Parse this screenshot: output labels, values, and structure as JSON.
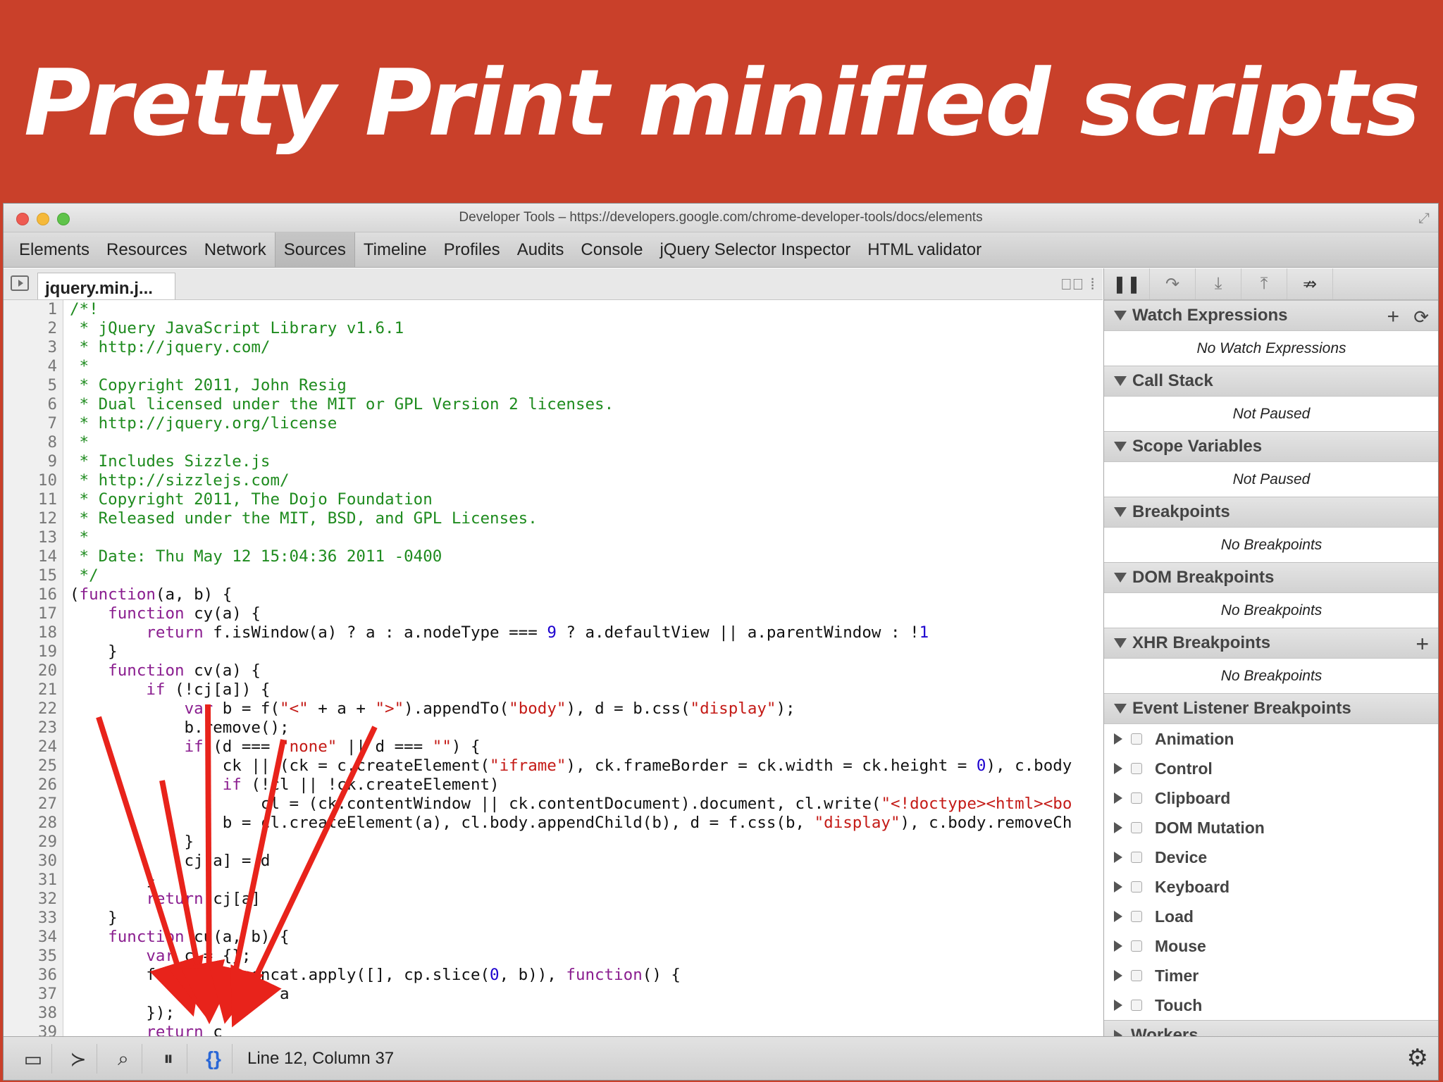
{
  "banner": {
    "title": "Pretty Print minified scripts"
  },
  "window": {
    "title": "Developer Tools – https://developers.google.com/chrome-developer-tools/docs/elements"
  },
  "tabs": [
    "Elements",
    "Resources",
    "Network",
    "Sources",
    "Timeline",
    "Profiles",
    "Audits",
    "Console",
    "jQuery Selector Inspector",
    "HTML validator"
  ],
  "active_tab": "Sources",
  "file": {
    "name": "jquery.min.j..."
  },
  "code_lines": [
    [
      [
        "c",
        "/*!"
      ]
    ],
    [
      [
        "c",
        " * jQuery JavaScript Library v1.6.1"
      ]
    ],
    [
      [
        "c",
        " * http://jquery.com/"
      ]
    ],
    [
      [
        "c",
        " *"
      ]
    ],
    [
      [
        "c",
        " * Copyright 2011, John Resig"
      ]
    ],
    [
      [
        "c",
        " * Dual licensed under the MIT or GPL Version 2 licenses."
      ]
    ],
    [
      [
        "c",
        " * http://jquery.org/license"
      ]
    ],
    [
      [
        "c",
        " *"
      ]
    ],
    [
      [
        "c",
        " * Includes Sizzle.js"
      ]
    ],
    [
      [
        "c",
        " * http://sizzlejs.com/"
      ]
    ],
    [
      [
        "c",
        " * Copyright 2011, The Dojo Foundation"
      ]
    ],
    [
      [
        "c",
        " * Released under the MIT, BSD, and GPL Licenses."
      ]
    ],
    [
      [
        "c",
        " *"
      ]
    ],
    [
      [
        "c",
        " * Date: Thu May 12 15:04:36 2011 -0400"
      ]
    ],
    [
      [
        "c",
        " */"
      ]
    ],
    [
      [
        "p",
        "("
      ],
      [
        "k",
        "function"
      ],
      [
        "p",
        "(a, b) {"
      ]
    ],
    [
      [
        "p",
        "    "
      ],
      [
        "k",
        "function"
      ],
      [
        "p",
        " cy(a) {"
      ]
    ],
    [
      [
        "p",
        "        "
      ],
      [
        "k",
        "return"
      ],
      [
        "p",
        " f.isWindow(a) ? a : a.nodeType === "
      ],
      [
        "n",
        "9"
      ],
      [
        "p",
        " ? a.defaultView || a.parentWindow : !"
      ],
      [
        "n",
        "1"
      ]
    ],
    [
      [
        "p",
        "    }"
      ]
    ],
    [
      [
        "p",
        "    "
      ],
      [
        "k",
        "function"
      ],
      [
        "p",
        " cv(a) {"
      ]
    ],
    [
      [
        "p",
        "        "
      ],
      [
        "k",
        "if"
      ],
      [
        "p",
        " (!cj[a]) {"
      ]
    ],
    [
      [
        "p",
        "            "
      ],
      [
        "k",
        "var"
      ],
      [
        "p",
        " b = f("
      ],
      [
        "s",
        "\"<\""
      ],
      [
        "p",
        " + a + "
      ],
      [
        "s",
        "\">\""
      ],
      [
        "p",
        ").appendTo("
      ],
      [
        "s",
        "\"body\""
      ],
      [
        "p",
        "), d = b.css("
      ],
      [
        "s",
        "\"display\""
      ],
      [
        "p",
        ");"
      ]
    ],
    [
      [
        "p",
        "            b.remove();"
      ]
    ],
    [
      [
        "p",
        "            "
      ],
      [
        "k",
        "if"
      ],
      [
        "p",
        " (d === "
      ],
      [
        "s",
        "\"none\""
      ],
      [
        "p",
        " || d === "
      ],
      [
        "s",
        "\"\""
      ],
      [
        "p",
        ") {"
      ]
    ],
    [
      [
        "p",
        "                ck || (ck = c.createElement("
      ],
      [
        "s",
        "\"iframe\""
      ],
      [
        "p",
        "), ck.frameBorder = ck.width = ck.height = "
      ],
      [
        "n",
        "0"
      ],
      [
        "p",
        "), c.body"
      ]
    ],
    [
      [
        "p",
        "                "
      ],
      [
        "k",
        "if"
      ],
      [
        "p",
        " (!cl || !ck.createElement)"
      ]
    ],
    [
      [
        "p",
        "                    cl = (ck.contentWindow || ck.contentDocument).document, cl.write("
      ],
      [
        "s",
        "\"<!doctype><html><bo"
      ]
    ],
    [
      [
        "p",
        "                b = cl.createElement(a), cl.body.appendChild(b), d = f.css(b, "
      ],
      [
        "s",
        "\"display\""
      ],
      [
        "p",
        "), c.body.removeCh"
      ]
    ],
    [
      [
        "p",
        "            }"
      ]
    ],
    [
      [
        "p",
        "            cj[a] = d"
      ]
    ],
    [
      [
        "p",
        "        }"
      ]
    ],
    [
      [
        "p",
        "        "
      ],
      [
        "k",
        "return"
      ],
      [
        "p",
        " cj[a]"
      ]
    ],
    [
      [
        "p",
        "    }"
      ]
    ],
    [
      [
        "p",
        "    "
      ],
      [
        "k",
        "function"
      ],
      [
        "p",
        " cu(a, b) {"
      ]
    ],
    [
      [
        "p",
        "        "
      ],
      [
        "k",
        "var"
      ],
      [
        "p",
        " c = {};"
      ]
    ],
    [
      [
        "p",
        "        f.each(cp.concat.apply([], cp.slice("
      ],
      [
        "n",
        "0"
      ],
      [
        "p",
        ", b)), "
      ],
      [
        "k",
        "function"
      ],
      [
        "p",
        "() {"
      ]
    ],
    [
      [
        "p",
        "            c[this] = a"
      ]
    ],
    [
      [
        "p",
        "        });"
      ]
    ],
    [
      [
        "p",
        "        "
      ],
      [
        "k",
        "return"
      ],
      [
        "p",
        " c"
      ]
    ]
  ],
  "panes": [
    {
      "title": "Watch Expressions",
      "body": "No Watch Expressions"
    },
    {
      "title": "Call Stack",
      "body": "Not Paused"
    },
    {
      "title": "Scope Variables",
      "body": "Not Paused"
    },
    {
      "title": "Breakpoints",
      "body": "No Breakpoints"
    },
    {
      "title": "DOM Breakpoints",
      "body": "No Breakpoints"
    },
    {
      "title": "XHR Breakpoints",
      "body": "No Breakpoints"
    },
    {
      "title": "Event Listener Breakpoints"
    }
  ],
  "event_listeners": [
    "Animation",
    "Control",
    "Clipboard",
    "DOM Mutation",
    "Device",
    "Keyboard",
    "Load",
    "Mouse",
    "Timer",
    "Touch"
  ],
  "workers_label": "Workers",
  "status": {
    "position": "Line 12, Column 37"
  },
  "colors": {
    "banner": "#c9402a",
    "comment": "#1e8b1e",
    "keyword": "#8a1d8f",
    "string": "#c41a16",
    "number": "#1c00cf",
    "arrow": "#e8231b",
    "pretty_print_icon": "#2a67d6"
  },
  "icons": [
    "toggle-navigator-icon",
    "pause-icon",
    "step-over-icon",
    "step-into-icon",
    "step-out-icon",
    "deactivate-breakpoints-icon",
    "add-icon",
    "refresh-icon",
    "dock-icon",
    "console-drawer-icon",
    "search-icon",
    "pause-exceptions-icon",
    "pretty-print-icon",
    "gear-icon"
  ]
}
